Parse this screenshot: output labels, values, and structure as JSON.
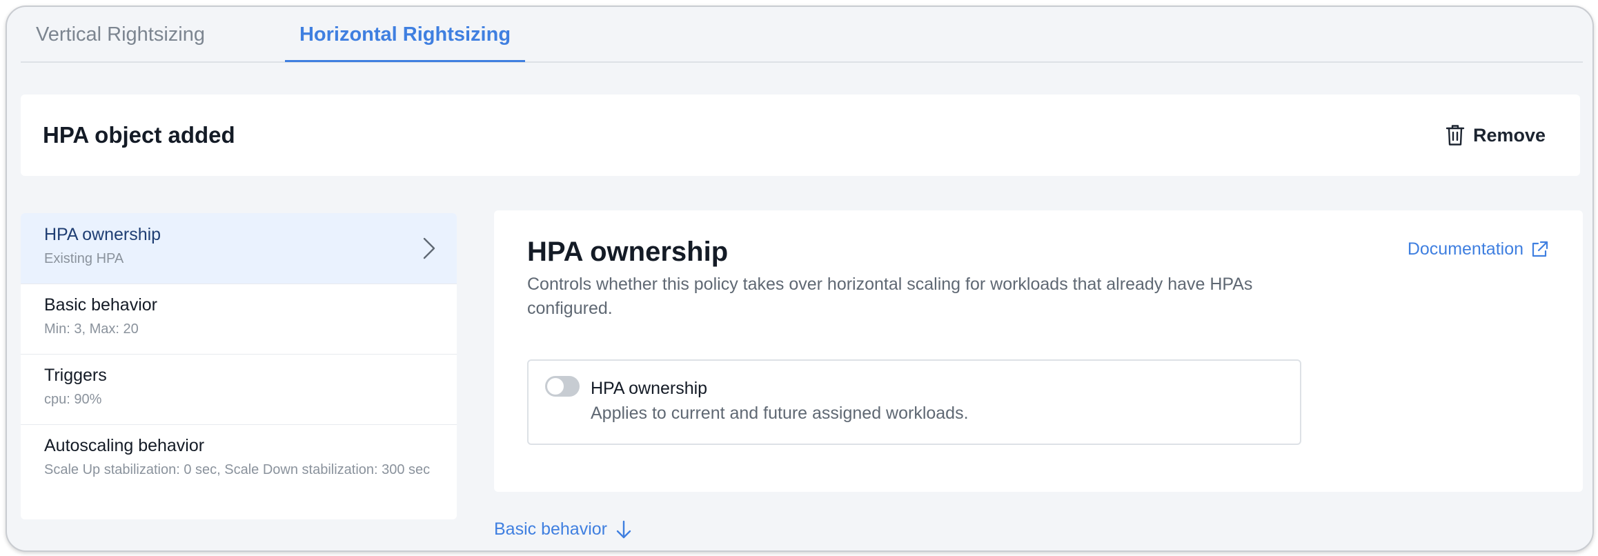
{
  "tabs": [
    {
      "label": "Vertical Rightsizing",
      "active": false
    },
    {
      "label": "Horizontal Rightsizing",
      "active": true
    }
  ],
  "banner": {
    "title": "HPA object added",
    "remove_label": "Remove",
    "remove_icon": "trash-icon"
  },
  "menu": {
    "items": [
      {
        "title": "HPA ownership",
        "subtitle": "Existing HPA",
        "selected": true
      },
      {
        "title": "Basic behavior",
        "subtitle": "Min: 3, Max: 20",
        "selected": false
      },
      {
        "title": "Triggers",
        "subtitle": "cpu: 90%",
        "selected": false
      },
      {
        "title": "Autoscaling behavior",
        "subtitle": "Scale Up stabilization: 0 sec, Scale Down stabilization: 300 sec",
        "selected": false
      }
    ]
  },
  "panel": {
    "title": "HPA ownership",
    "description": "Controls whether this policy takes over horizontal scaling for workloads that already have HPAs configured.",
    "doc_label": "Documentation",
    "doc_icon": "external-link-icon",
    "ownership": {
      "title": "HPA ownership",
      "description": "Applies to current and future assigned workloads.",
      "enabled": false
    }
  },
  "next_section": {
    "label": "Basic behavior",
    "icon": "arrow-down-icon"
  },
  "colors": {
    "accent": "#3f7fe0",
    "background": "#f3f5f8",
    "selected_item": "#eaf2fe"
  }
}
